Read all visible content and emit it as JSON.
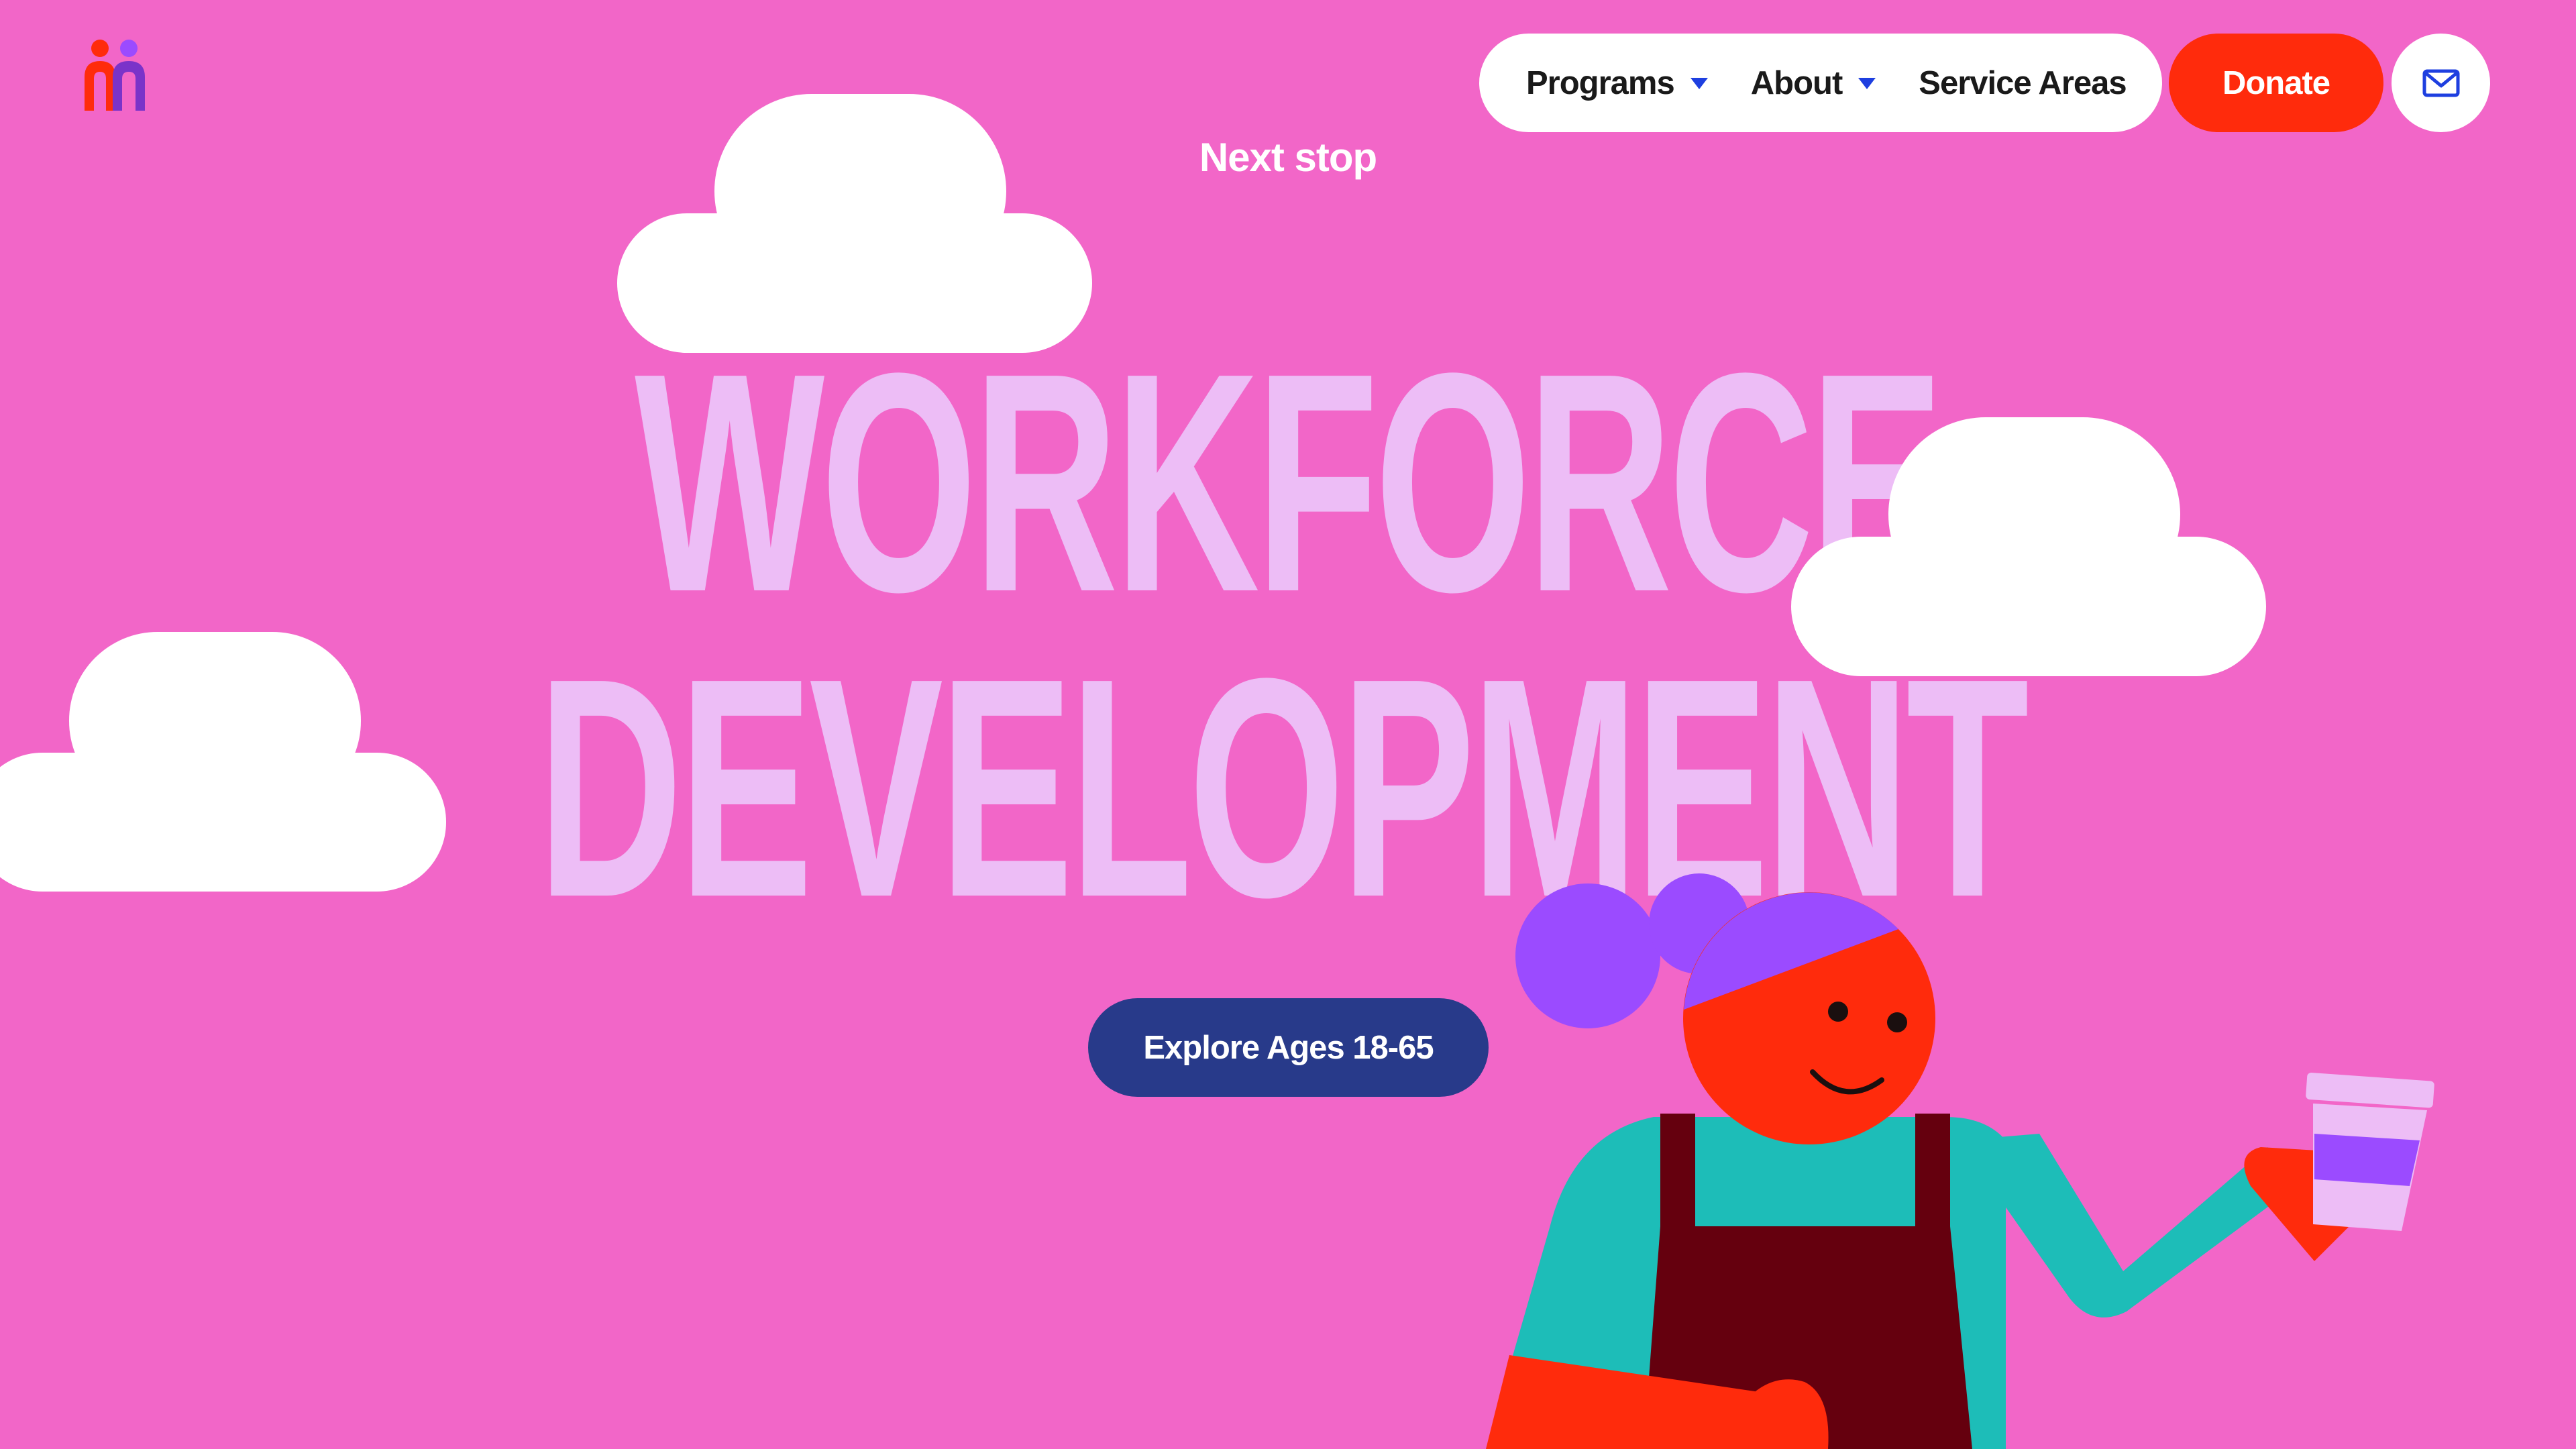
{
  "nav": {
    "items": [
      {
        "label": "Programs",
        "has_dropdown": true
      },
      {
        "label": "About",
        "has_dropdown": true
      },
      {
        "label": "Service Areas",
        "has_dropdown": false
      }
    ],
    "donate_label": "Donate",
    "mail_icon": "mail-icon"
  },
  "hero": {
    "kicker": "Next stop",
    "headline_line1": "WORKFORCE",
    "headline_line2": "DEVELOPMENT",
    "cta_label": "Explore Ages 18-65"
  },
  "colors": {
    "background": "#F266C8",
    "headline": "#EDBDF6",
    "accent_red": "#FF2B0C",
    "cta_navy": "#283A8A",
    "nav_caret": "#1E3FE0",
    "teal": "#1DBDB8",
    "maroon": "#65000E",
    "purple": "#9B4BFF"
  }
}
